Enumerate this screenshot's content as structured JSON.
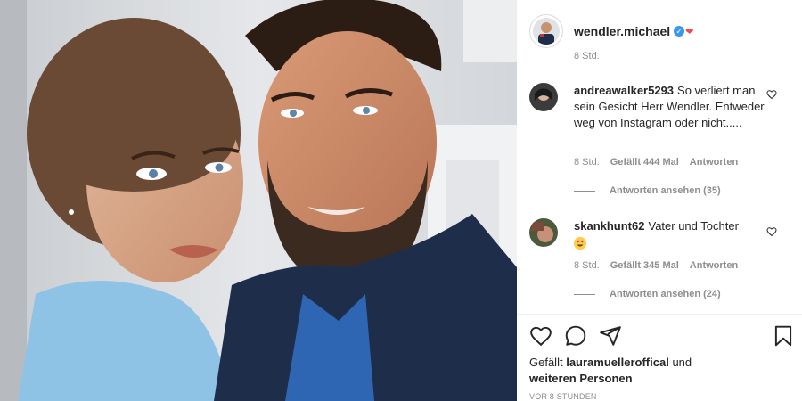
{
  "post": {
    "username": "wendler.michael",
    "time": "8 Std.",
    "verified": true
  },
  "comments": [
    {
      "user": "andreawalker5293",
      "text": "So verliert man sein Gesicht Herr Wendler. Entweder weg von Instagram oder nicht.....",
      "time": "8 Std.",
      "likes": "Gefällt 444 Mal",
      "reply": "Antworten",
      "view_replies": "Antworten ansehen (35)"
    },
    {
      "user": "skankhunt62",
      "text": "Vater und Tochter",
      "emoji": "heart-eyes-emoji",
      "time": "8 Std.",
      "likes": "Gefällt 345 Mal",
      "reply": "Antworten",
      "view_replies": "Antworten ansehen (24)"
    }
  ],
  "actions": [
    "heart-icon",
    "comment-icon",
    "share-icon",
    "bookmark-icon"
  ],
  "liked_by": {
    "prefix": "Gefällt",
    "user": "lauramuelleroffical",
    "suffix": "und",
    "others": "weiteren Personen"
  },
  "timestamp": "VOR 8 STUNDEN",
  "colors": {
    "verified": "#3897f0",
    "meta_text": "#8e8e8e",
    "text": "#262626"
  }
}
